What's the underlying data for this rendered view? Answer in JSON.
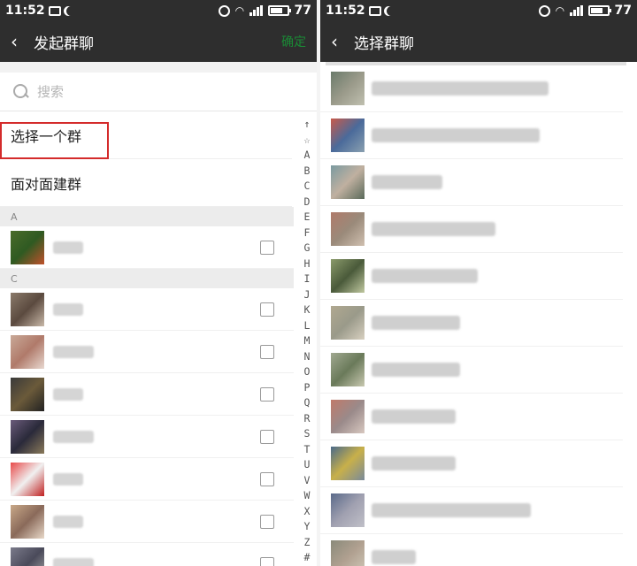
{
  "status": {
    "time": "11:52",
    "battery": "77",
    "battery_level": 0.77
  },
  "left": {
    "title": "发起群聊",
    "confirm": "确定",
    "search_placeholder": "搜索",
    "option_select_group": "选择一个群",
    "option_face_to_face": "面对面建群",
    "sections": [
      {
        "letter": "A",
        "rows": [
          {
            "avatar": [
              "#4a6b2a",
              "#2f5a22",
              "#c0512b"
            ]
          }
        ]
      },
      {
        "letter": "C",
        "rows": [
          {
            "avatar": [
              "#8a7a6a",
              "#5b4a3f",
              "#c8b8a8"
            ]
          },
          {
            "avatar": [
              "#c9a998",
              "#b07a6a",
              "#e8d8d0"
            ]
          },
          {
            "avatar": [
              "#3a3a3a",
              "#6b5a3a",
              "#222"
            ]
          },
          {
            "avatar": [
              "#6a5a7a",
              "#2a2a3a",
              "#8a7a5a"
            ]
          },
          {
            "avatar": [
              "#e84a4a",
              "#f0f0f0",
              "#c02020"
            ]
          },
          {
            "avatar": [
              "#c8a888",
              "#8a6a5a",
              "#e8d8c8"
            ]
          },
          {
            "avatar": [
              "#7a7a8a",
              "#4a4a5a",
              "#aaa"
            ]
          }
        ]
      }
    ],
    "index_letters": [
      "↑",
      "☆",
      "A",
      "B",
      "C",
      "D",
      "E",
      "F",
      "G",
      "H",
      "I",
      "J",
      "K",
      "L",
      "M",
      "N",
      "O",
      "P",
      "Q",
      "R",
      "S",
      "T",
      "U",
      "V",
      "W",
      "X",
      "Y",
      "Z",
      "#"
    ]
  },
  "right": {
    "title": "选择群聊",
    "groups": [
      {
        "avatar": [
          "#6a7a6a",
          "#9a9a8a",
          "#c0c0b0"
        ]
      },
      {
        "avatar": [
          "#c85a4a",
          "#4a6a9a",
          "#8aa0b0"
        ]
      },
      {
        "avatar": [
          "#7a9aa0",
          "#c0b0a0",
          "#5a6a5a"
        ]
      },
      {
        "avatar": [
          "#b07a6a",
          "#9a8a7a",
          "#d0c0b0"
        ]
      },
      {
        "avatar": [
          "#8a9a6a",
          "#4a5a3a",
          "#c0c8a0"
        ]
      },
      {
        "avatar": [
          "#b0a890",
          "#9a9a8a",
          "#d8d0c0"
        ]
      },
      {
        "avatar": [
          "#a0a890",
          "#6a7a5a",
          "#c8c8b0"
        ]
      },
      {
        "avatar": [
          "#c07a6a",
          "#9a8a8a",
          "#d8c8c0"
        ]
      },
      {
        "avatar": [
          "#4a6a8a",
          "#c8b04a",
          "#7a8a9a"
        ]
      },
      {
        "avatar": [
          "#5a6a8a",
          "#a0a0b0",
          "#c0c0c8"
        ]
      },
      {
        "avatar": [
          "#8a8a7a",
          "#b0a090",
          "#d0c8b8"
        ]
      }
    ]
  }
}
